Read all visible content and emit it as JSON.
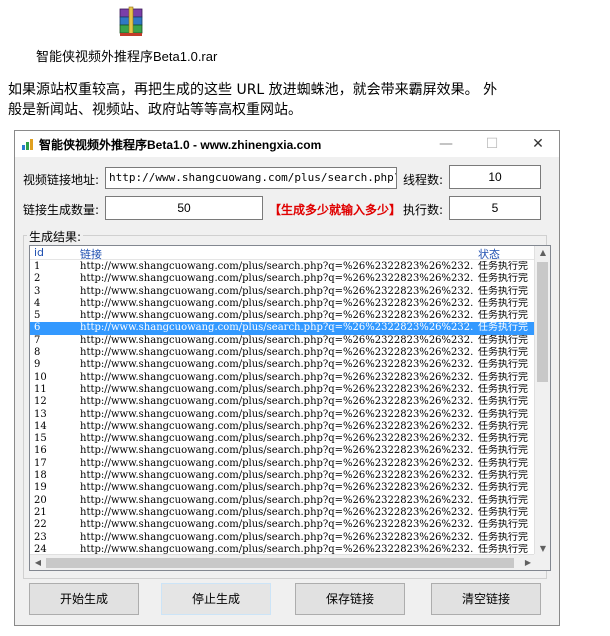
{
  "file": {
    "caption": "智能侠视频外推程序Beta1.0.rar"
  },
  "article": {
    "line1": "如果源站权重较高，再把生成的这些 URL 放进蜘蛛池，就会带来霸屏效果。  外",
    "line2": "般是新闻站、视频站、政府站等等高权重网站。"
  },
  "window": {
    "title": "智能侠视频外推程序Beta1.0 - www.zhinengxia.com",
    "min": "—",
    "max": "☐",
    "close": "✕"
  },
  "form": {
    "link_label": "视频链接地址:",
    "link_value": "http://www.shangcuowang.com/plus/search.php?q=%26%2",
    "threads_label": "线程数:",
    "threads_value": "10",
    "count_label": "链接生成数量:",
    "count_value": "50",
    "hint": "【生成多少就输入多少】",
    "exec_label": "执行数:",
    "exec_value": "5"
  },
  "results": {
    "group_title": "生成结果:",
    "headers": {
      "id": "id",
      "link": "链接",
      "status": "状态"
    },
    "selected_index": 5,
    "rows": [
      {
        "id": "1",
        "link": "http://www.shangcuowang.com/plus/search.php?q=%26%2322823%26%232...",
        "status": "任务执行完"
      },
      {
        "id": "2",
        "link": "http://www.shangcuowang.com/plus/search.php?q=%26%2322823%26%232...",
        "status": "任务执行完"
      },
      {
        "id": "3",
        "link": "http://www.shangcuowang.com/plus/search.php?q=%26%2322823%26%232...",
        "status": "任务执行完"
      },
      {
        "id": "4",
        "link": "http://www.shangcuowang.com/plus/search.php?q=%26%2322823%26%232...",
        "status": "任务执行完"
      },
      {
        "id": "5",
        "link": "http://www.shangcuowang.com/plus/search.php?q=%26%2322823%26%232...",
        "status": "任务执行完"
      },
      {
        "id": "6",
        "link": "http://www.shangcuowang.com/plus/search.php?q=%26%2322823%26%232...",
        "status": "任务执行完"
      },
      {
        "id": "7",
        "link": "http://www.shangcuowang.com/plus/search.php?q=%26%2322823%26%232...",
        "status": "任务执行完"
      },
      {
        "id": "8",
        "link": "http://www.shangcuowang.com/plus/search.php?q=%26%2322823%26%232...",
        "status": "任务执行完"
      },
      {
        "id": "9",
        "link": "http://www.shangcuowang.com/plus/search.php?q=%26%2322823%26%232...",
        "status": "任务执行完"
      },
      {
        "id": "10",
        "link": "http://www.shangcuowang.com/plus/search.php?q=%26%2322823%26%232...",
        "status": "任务执行完"
      },
      {
        "id": "11",
        "link": "http://www.shangcuowang.com/plus/search.php?q=%26%2322823%26%232...",
        "status": "任务执行完"
      },
      {
        "id": "12",
        "link": "http://www.shangcuowang.com/plus/search.php?q=%26%2322823%26%232...",
        "status": "任务执行完"
      },
      {
        "id": "13",
        "link": "http://www.shangcuowang.com/plus/search.php?q=%26%2322823%26%232...",
        "status": "任务执行完"
      },
      {
        "id": "14",
        "link": "http://www.shangcuowang.com/plus/search.php?q=%26%2322823%26%232...",
        "status": "任务执行完"
      },
      {
        "id": "15",
        "link": "http://www.shangcuowang.com/plus/search.php?q=%26%2322823%26%232...",
        "status": "任务执行完"
      },
      {
        "id": "16",
        "link": "http://www.shangcuowang.com/plus/search.php?q=%26%2322823%26%232...",
        "status": "任务执行完"
      },
      {
        "id": "17",
        "link": "http://www.shangcuowang.com/plus/search.php?q=%26%2322823%26%232...",
        "status": "任务执行完"
      },
      {
        "id": "18",
        "link": "http://www.shangcuowang.com/plus/search.php?q=%26%2322823%26%232...",
        "status": "任务执行完"
      },
      {
        "id": "19",
        "link": "http://www.shangcuowang.com/plus/search.php?q=%26%2322823%26%232...",
        "status": "任务执行完"
      },
      {
        "id": "20",
        "link": "http://www.shangcuowang.com/plus/search.php?q=%26%2322823%26%232...",
        "status": "任务执行完"
      },
      {
        "id": "21",
        "link": "http://www.shangcuowang.com/plus/search.php?q=%26%2322823%26%232...",
        "status": "任务执行完"
      },
      {
        "id": "22",
        "link": "http://www.shangcuowang.com/plus/search.php?q=%26%2322823%26%232...",
        "status": "任务执行完"
      },
      {
        "id": "23",
        "link": "http://www.shangcuowang.com/plus/search.php?q=%26%2322823%26%232...",
        "status": "任务执行完"
      },
      {
        "id": "24",
        "link": "http://www.shangcuowang.com/plus/search.php?q=%26%2322823%26%232...",
        "status": "任务执行完"
      }
    ]
  },
  "buttons": {
    "start": "开始生成",
    "stop": "停止生成",
    "save": "保存链接",
    "clear": "清空链接"
  },
  "colors": {
    "selection": "#3399ff",
    "hint": "#e00000",
    "header_text": "#1e4fb0"
  }
}
